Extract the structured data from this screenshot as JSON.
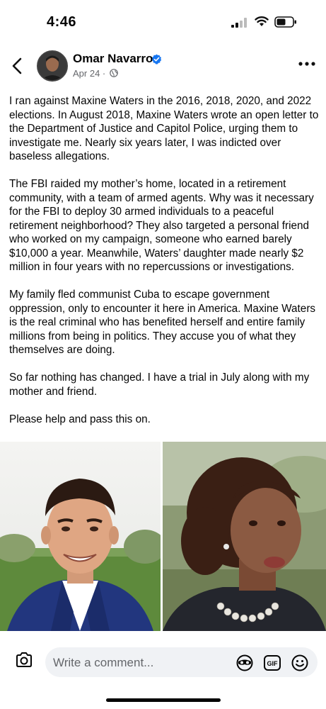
{
  "status_bar": {
    "time": "4:46"
  },
  "post": {
    "author": "Omar Navarro",
    "date": "Apr 24",
    "separator": " · ",
    "paragraphs": [
      "I ran against Maxine Waters in the 2016, 2018, 2020, and 2022 elections. In August 2018, Maxine Waters wrote an open letter to the Department of Justice and Capitol Police, urging them to investigate me. Nearly six years later, I was indicted over baseless allegations.",
      "The FBI raided my mother’s home, located in a retirement community, with a team of armed agents. Why was it necessary for the FBI to deploy 30 armed individuals to a peaceful retirement neighborhood? They also targeted a personal friend who worked on my campaign, someone who earned barely $10,000 a year. Meanwhile, Waters’ daughter made nearly $2 million in four years with no repercussions or investigations.",
      "My family fled communist Cuba to escape government oppression, only to encounter it here in America. Maxine Waters is the real criminal who has benefited herself and entire family millions from being in politics. They accuse you of what they themselves are doing.",
      "So far nothing has changed. I have a trial in July along with my mother and friend.",
      "Please help and pass this on."
    ]
  },
  "comment_bar": {
    "placeholder": "Write a comment..."
  },
  "icons": {
    "back": "chevron-left-icon",
    "verified": "verified-badge-icon",
    "audience": "globe-icon",
    "more": "more-horizontal-icon",
    "camera": "camera-icon",
    "avatar_mask": "avatar-sticker-icon",
    "gif": "gif-icon",
    "emoji": "smiley-icon"
  },
  "colors": {
    "verified_blue": "#1877f2",
    "meta_gray": "#65676b",
    "field_bg": "#f0f2f5"
  }
}
